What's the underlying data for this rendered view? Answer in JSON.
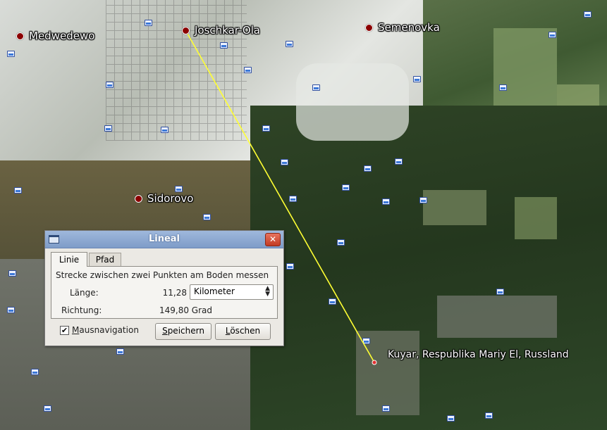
{
  "map": {
    "places": [
      {
        "name": "Medwedewo",
        "id": "medwedewo"
      },
      {
        "name": "Joschkar-Ola",
        "id": "joschkar-ola"
      },
      {
        "name": "Semenovka",
        "id": "semenovka"
      },
      {
        "name": "Sidorovo",
        "id": "sidorovo"
      }
    ],
    "target_label": "Kuyar, Respublika Mariy El, Russland",
    "ruler_line_color": "#ffff33"
  },
  "dialog": {
    "title": "Lineal",
    "close_icon": "close-icon",
    "tabs": [
      {
        "label": "Linie",
        "active": true
      },
      {
        "label": "Pfad",
        "active": false
      }
    ],
    "description": "Strecke zwischen zwei Punkten am Boden messen",
    "length_label": "Länge:",
    "length_value": "11,28",
    "unit_selected": "Kilometer",
    "direction_label": "Richtung:",
    "direction_value": "149,80 Grad",
    "mouse_nav_checked": true,
    "mouse_nav_label": "Mausnavigation",
    "save_button": "Speichern",
    "delete_button": "Löschen"
  }
}
